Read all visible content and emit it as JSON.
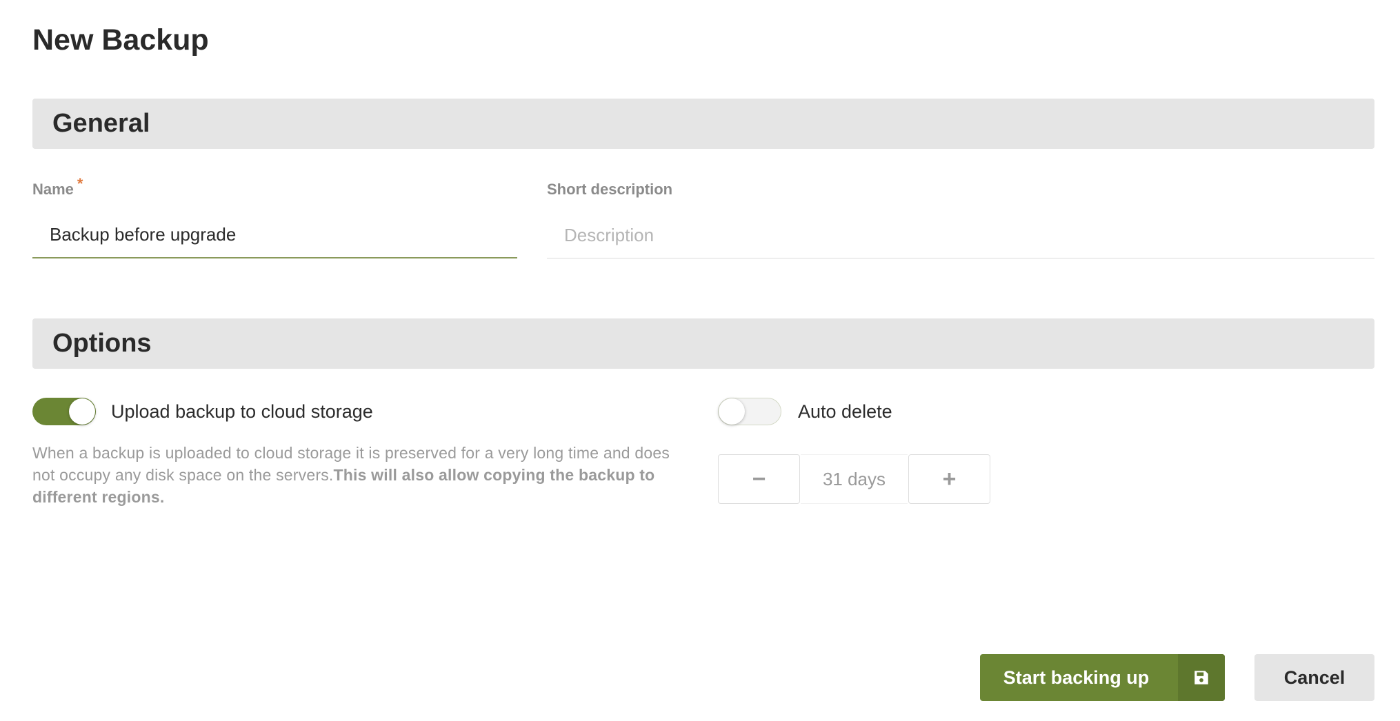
{
  "page": {
    "title": "New Backup"
  },
  "general": {
    "title": "General",
    "name_label": "Name",
    "required_marker": "*",
    "name_value": "Backup before upgrade",
    "description_label": "Short description",
    "description_placeholder": "Description",
    "description_value": ""
  },
  "options": {
    "title": "Options",
    "upload": {
      "label": "Upload backup to cloud storage",
      "enabled": true,
      "help_text": "When a backup is uploaded to cloud storage it is preserved for a very long time and does not occupy any disk space on the servers.",
      "help_text_bold": "This will also allow copying the backup to different regions."
    },
    "auto_delete": {
      "label": "Auto delete",
      "enabled": false,
      "decrement_label": "−",
      "increment_label": "+",
      "value_text": "31 days"
    }
  },
  "actions": {
    "start_label": "Start backing up",
    "start_icon": "save-icon",
    "cancel_label": "Cancel"
  },
  "colors": {
    "accent": "#6b8634",
    "section_bg": "#e5e5e5",
    "required": "#e07a3f"
  }
}
